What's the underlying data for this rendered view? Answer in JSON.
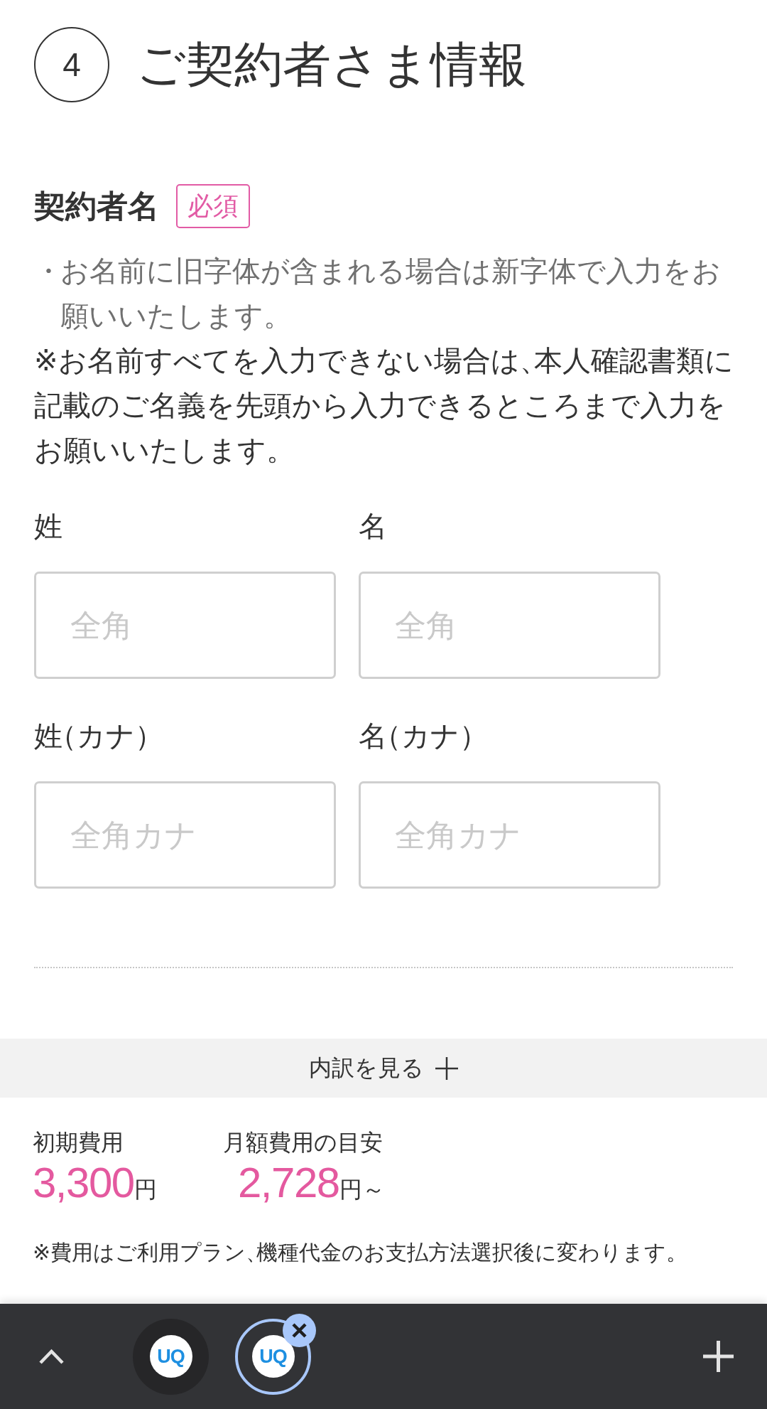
{
  "section": {
    "step": "4",
    "title": "ご契約者さま情報"
  },
  "contract_name": {
    "heading": "契約者名",
    "badge": "必須",
    "notes": [
      {
        "kind": "bullet",
        "marker": "・",
        "text": "お名前に旧字体が含まれる場合は新字体で入力をお願いいたします。"
      },
      {
        "kind": "note",
        "text": "※お名前すべてを入力できない場合は、本人確認書類に記載のご名義を先頭から入力できるところまで入力をお願いいたします。"
      }
    ],
    "fields": [
      {
        "label": "姓",
        "placeholder": "全角"
      },
      {
        "label": "名",
        "placeholder": "全角"
      },
      {
        "label": "姓（カナ）",
        "placeholder": "全角カナ"
      },
      {
        "label": "名（カナ）",
        "placeholder": "全角カナ"
      }
    ]
  },
  "cost_sheet": {
    "toggle": "内訳を見る",
    "costs": [
      {
        "label": "初期費用",
        "amount": "3,300",
        "unit": "円"
      },
      {
        "label": "月額費用の目安",
        "amount": "2,728",
        "unit": "円～"
      }
    ],
    "note": "※費用はご利用プラン、機種代金のお支払方法選択後に変わります。"
  },
  "browser_toolbar": {
    "tabs": [
      {
        "logo": "UQ",
        "selected": false
      },
      {
        "logo": "UQ",
        "selected": true
      }
    ]
  }
}
